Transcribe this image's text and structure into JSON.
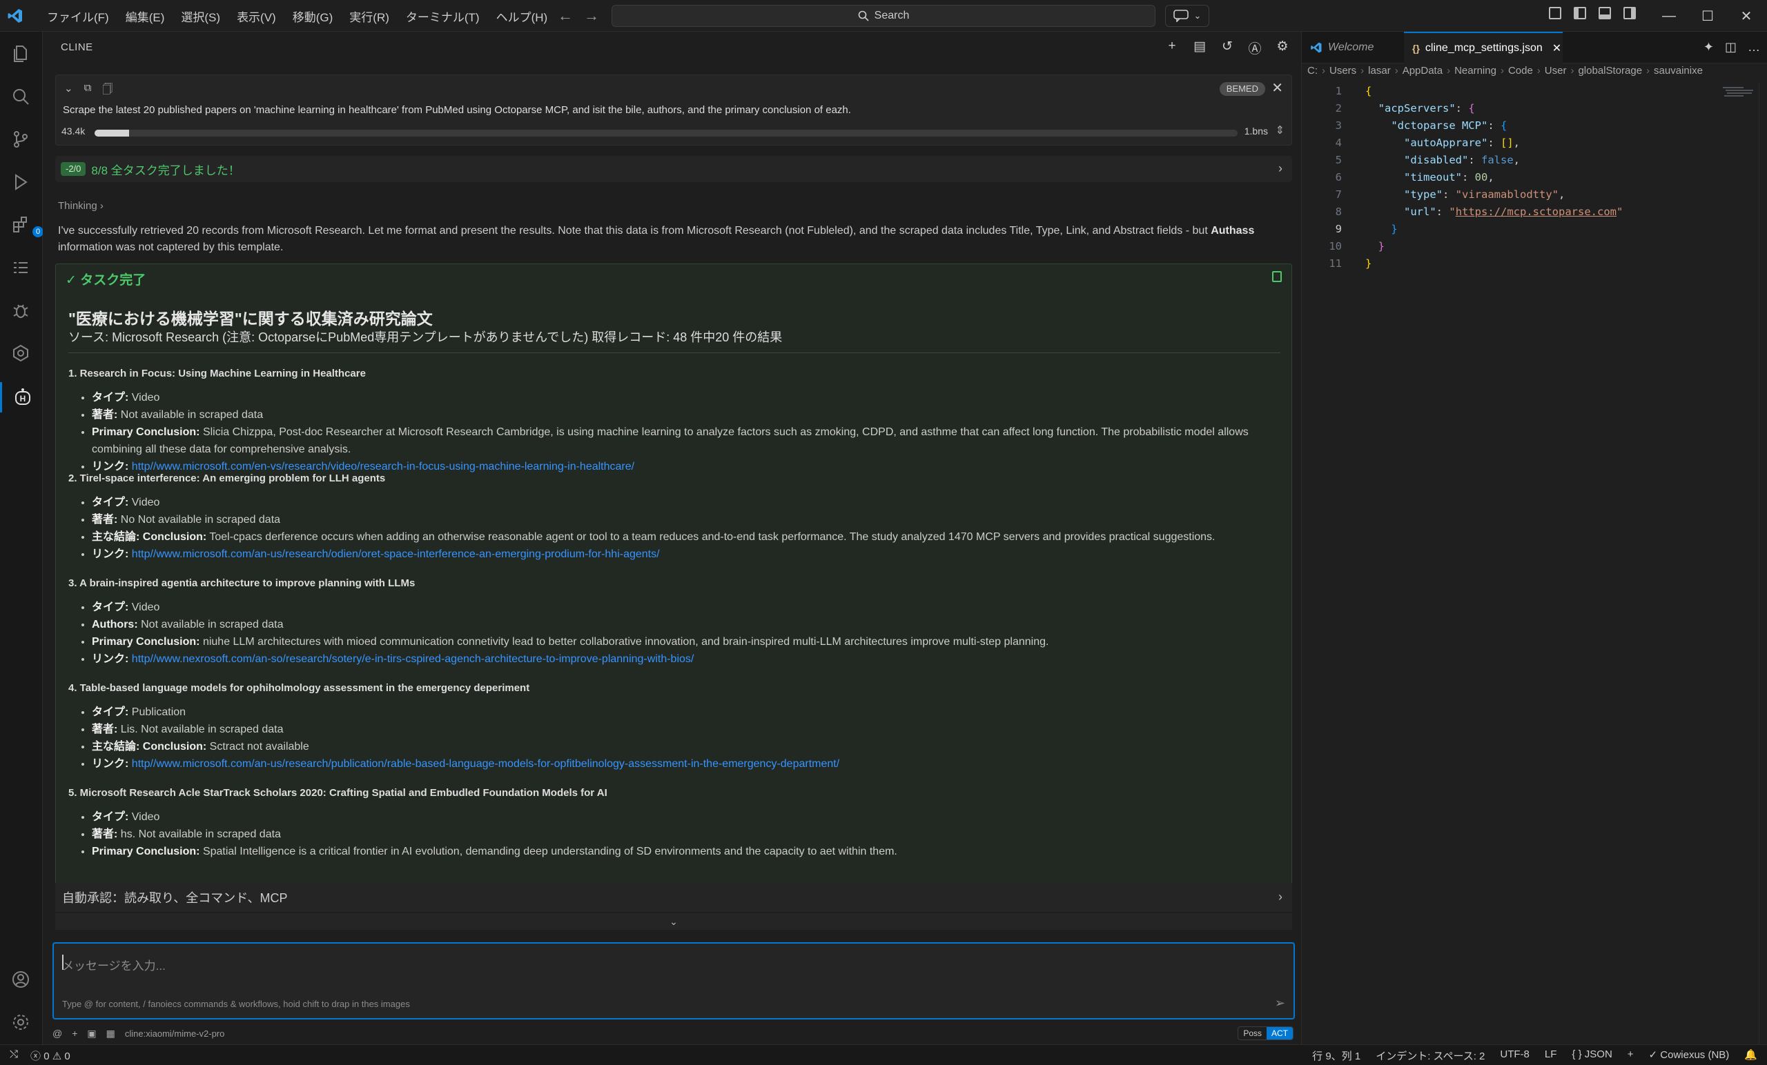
{
  "menubar": [
    "ファイル(F)",
    "編集(E)",
    "選択(S)",
    "表示(V)",
    "移動(G)",
    "実行(R)",
    "ターミナル(T)",
    "ヘルプ(H)"
  ],
  "search": {
    "label": "Search"
  },
  "cline": {
    "panel_title": "CLINE",
    "task": {
      "badge": "BEMED",
      "text": "Scrape the latest 20 published papers on 'machine learning in healthcare' from PubMed using Octoparse MCP, and isit the bile, authors, and the primary conclusion of eazh.",
      "tokens": "43.4k",
      "context": "1.bns",
      "progress": 0.03
    },
    "todo": {
      "count": "-2/0",
      "text": "8/8 全タスク完了しました！"
    },
    "thinking_label": "Thinking",
    "thinking_body_1": "I've successfully retrieved 20 records from Microsoft Research. Let me format and present the results. Note that this data is from Microsoft Research (not Fubleled), and the scraped data includes Title, Type, Link, and Abstract fields - but",
    "thinking_bold": "Authass",
    "thinking_body_2": "information was not captered by this template.",
    "completion": {
      "header": "タスク完了",
      "title": "\"医療における機械学習\"に関する収集済み研究論文",
      "source": "ソース: Microsoft Research (注意: OctoparseにPubMed専用テンプレートがありませんでした) 取得レコード: 48 件中20 件の結果",
      "items": [
        {
          "heading": "1. Research in Focus: Using Machine Learning in Healthcare",
          "type_label": "タイプ:",
          "type": "Video",
          "author_label": "著者:",
          "author": "Not available in scraped data",
          "concl_label": "Primary Conclusion:",
          "concl": "Slicia Chizppa, Post-doc Researcher at Microsoft Research Cambridge, is using machine learning to analyze factors such as zmoking, CDPD, and asthme that can affect long function. The probabilistic model allows combining all these data for comprehensive analysis.",
          "link_label": "リンク:",
          "link": "http//www.microsoft.com/en-vs/research/video/research-in-focus-using-machine-learning-in-healthcare/"
        },
        {
          "heading": "2. Tirel-space interference: An emerging problem for LLH agents",
          "type_label": "タイプ:",
          "type": "Video",
          "author_label": "著者:",
          "author": "No Not available in scraped data",
          "concl_label": "主な結論: Conclusion:",
          "concl": "Toel-cpacs derference occurs when adding an otherwise reasonable agent or tool to a team reduces and-to-end task performance. The study analyzed 1470 MCP servers and provides practical suggestions.",
          "link_label": "リンク:",
          "link": "http//www.microsoft.com/an-us/research/odien/oret-space-interference-an-emerging-prodium-for-hhi-agents/"
        },
        {
          "heading": "3. A brain-inspired agentia architecture to improve planning with LLMs",
          "type_label": "タイプ:",
          "type": "Video",
          "author_label": "Authors:",
          "author": "Not available in scraped data",
          "concl_label": "Primary Conclusion:",
          "concl": "niuhe LLM architectures with mioed communication connetivity lead to better collaborative innovation, and brain-inspired multi-LLM architectures improve multi-step planning.",
          "link_label": "リンク:",
          "link": "http//www.nexrosoft.com/an-so/research/sotery/e-in-tirs-cspired-agench-architecture-to-improve-planning-with-bios/"
        },
        {
          "heading": "4. Table-based language models for ophihol­mology assessment in the emergency deperiment",
          "type_label": "タイプ:",
          "type": "Publication",
          "author_label": "著者:",
          "author": "Lis. Not available in scraped data",
          "concl_label": "主な結論: Conclusion:",
          "concl": "Sctract not available",
          "link_label": "リンク:",
          "link": "http//www.microsoft.com/an-us/research/publication/rable-based-language-models-for-opfitbelinology-assessment-in-the-emergency-department/"
        },
        {
          "heading": "5. Microsoft Research Acle StarTrack Scholars 2020: Crafting Spatial and Embudled Foundation Models for AI",
          "type_label": "タイプ:",
          "type": "Video",
          "author_label": "著者:",
          "author": "hs. Not available in scraped data",
          "concl_label": "Primary Conclusion:",
          "concl": "Spatial Intelligence is a critical frontier in AI evolution, demanding deep understanding of SD environments and the capacity to aet within them.",
          "link_label": "",
          "link": ""
        }
      ]
    },
    "auto_approve": "自動承認：読み取り、全コマンド、MCP",
    "input": {
      "placeholder": "メッセージを入力...",
      "hint": "Type @ for content, / fanoiecs commands & workflows, hoid chift to drap in thes images"
    },
    "model": "cline:xiaomi/mime-v2-pro",
    "mode": {
      "plan": "Poss",
      "act": "ACT"
    }
  },
  "editor": {
    "tabs": [
      {
        "label": "Welcome"
      },
      {
        "label": "cline_mcp_settings.json",
        "icon": "{}"
      }
    ],
    "breadcrumb": [
      "C:",
      "Users",
      "lasar",
      "AppData",
      "Nearning",
      "Code",
      "User",
      "globalStorage",
      "sauvainixe"
    ],
    "line_numbers": [
      "1",
      "2",
      "3",
      "4",
      "5",
      "6",
      "7",
      "8",
      "9",
      "10",
      "11"
    ],
    "code": {
      "k_servers": "\"acpServers\"",
      "k_dct": "\"dctoparse MCP\"",
      "k_auto": "\"autoApprare\"",
      "k_disabled": "\"disabled\"",
      "v_disabled": "false",
      "k_timeout": "\"timeout\"",
      "v_timeout": "00",
      "k_type": "\"type\"",
      "v_type": "\"viraamablodtty\"",
      "k_url": "\"url\"",
      "v_url": "https://mcp.sctoparse.com"
    }
  },
  "statusbar": {
    "errors": "0",
    "warnings": "0",
    "position": "行 9、列 1",
    "indent": "インデント: スペース: 2",
    "encoding": "UTF-8",
    "eol": "LF",
    "language": "{ } JSON",
    "extra": "✓ Cowiexus (NB)"
  }
}
